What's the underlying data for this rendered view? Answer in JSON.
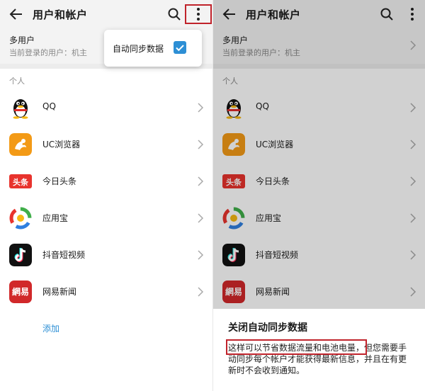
{
  "left": {
    "header": {
      "title": "用户和帐户",
      "back_icon": "back-arrow-icon",
      "search_icon": "search-icon",
      "more_icon": "more-vertical-icon"
    },
    "multi_user": {
      "title": "多用户",
      "subtitle": "当前登录的用户：机主"
    },
    "section_label": "个人",
    "accounts": [
      {
        "label": "QQ",
        "icon": "qq-penguin-icon"
      },
      {
        "label": "UC浏览器",
        "icon": "uc-browser-icon"
      },
      {
        "label": "今日头条",
        "icon": "toutiao-icon",
        "icon_text": "头条"
      },
      {
        "label": "应用宝",
        "icon": "yingyongbao-icon"
      },
      {
        "label": "抖音短视频",
        "icon": "douyin-icon"
      },
      {
        "label": "网易新闻",
        "icon": "netease-news-icon",
        "icon_text": "網易"
      }
    ],
    "add_label": "添加",
    "popup": {
      "label": "自动同步数据",
      "checked": true
    }
  },
  "right": {
    "header": {
      "title": "用户和帐户"
    },
    "multi_user": {
      "title": "多用户",
      "subtitle": "当前登录的用户：机主"
    },
    "section_label": "个人",
    "accounts": [
      {
        "label": "QQ"
      },
      {
        "label": "UC浏览器"
      },
      {
        "label": "今日头条",
        "icon_text": "头条"
      },
      {
        "label": "应用宝"
      },
      {
        "label": "抖音短视频"
      },
      {
        "label": "网易新闻",
        "icon_text": "網易"
      }
    ],
    "dialog": {
      "title": "关闭自动同步数据",
      "message_highlight": "这样可以节省数据流量和电池电量，",
      "message_rest": "但您需要手动同步每个帐户才能获得最新信息，并且在有更新时不会收到通知。"
    }
  },
  "colors": {
    "accent": "#2d8fd5",
    "highlight_border": "#c0232b",
    "toutiao_red": "#e8332d",
    "netease_red": "#d1282a",
    "uc_orange": "#f39a16"
  }
}
